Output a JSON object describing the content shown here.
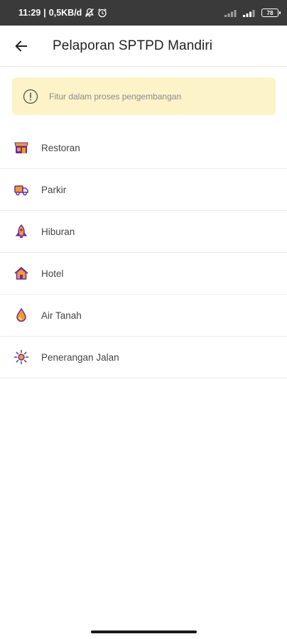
{
  "status_bar": {
    "time": "11:29",
    "network_speed": "0,5KB/d",
    "battery_level": "78",
    "icons": [
      "mute-icon",
      "alarm-icon",
      "signal-icon",
      "signal-icon",
      "battery-icon"
    ]
  },
  "app_bar": {
    "back_icon": "arrow-left-icon",
    "title": "Pelaporan SPTPD Mandiri"
  },
  "notice": {
    "icon": "alert-circle-icon",
    "text": "Fitur dalam proses pengembangan",
    "background_color": "#fdf3c8"
  },
  "menu": {
    "items": [
      {
        "label": "Restoran",
        "icon": "store-icon"
      },
      {
        "label": "Parkir",
        "icon": "truck-icon"
      },
      {
        "label": "Hiburan",
        "icon": "rocket-icon"
      },
      {
        "label": "Hotel",
        "icon": "home-icon"
      },
      {
        "label": "Air Tanah",
        "icon": "water-drop-icon"
      },
      {
        "label": "Penerangan Jalan",
        "icon": "sun-icon"
      }
    ]
  },
  "colors": {
    "accent_purple": "#6a2ea0",
    "accent_orange": "#f29a2e"
  }
}
